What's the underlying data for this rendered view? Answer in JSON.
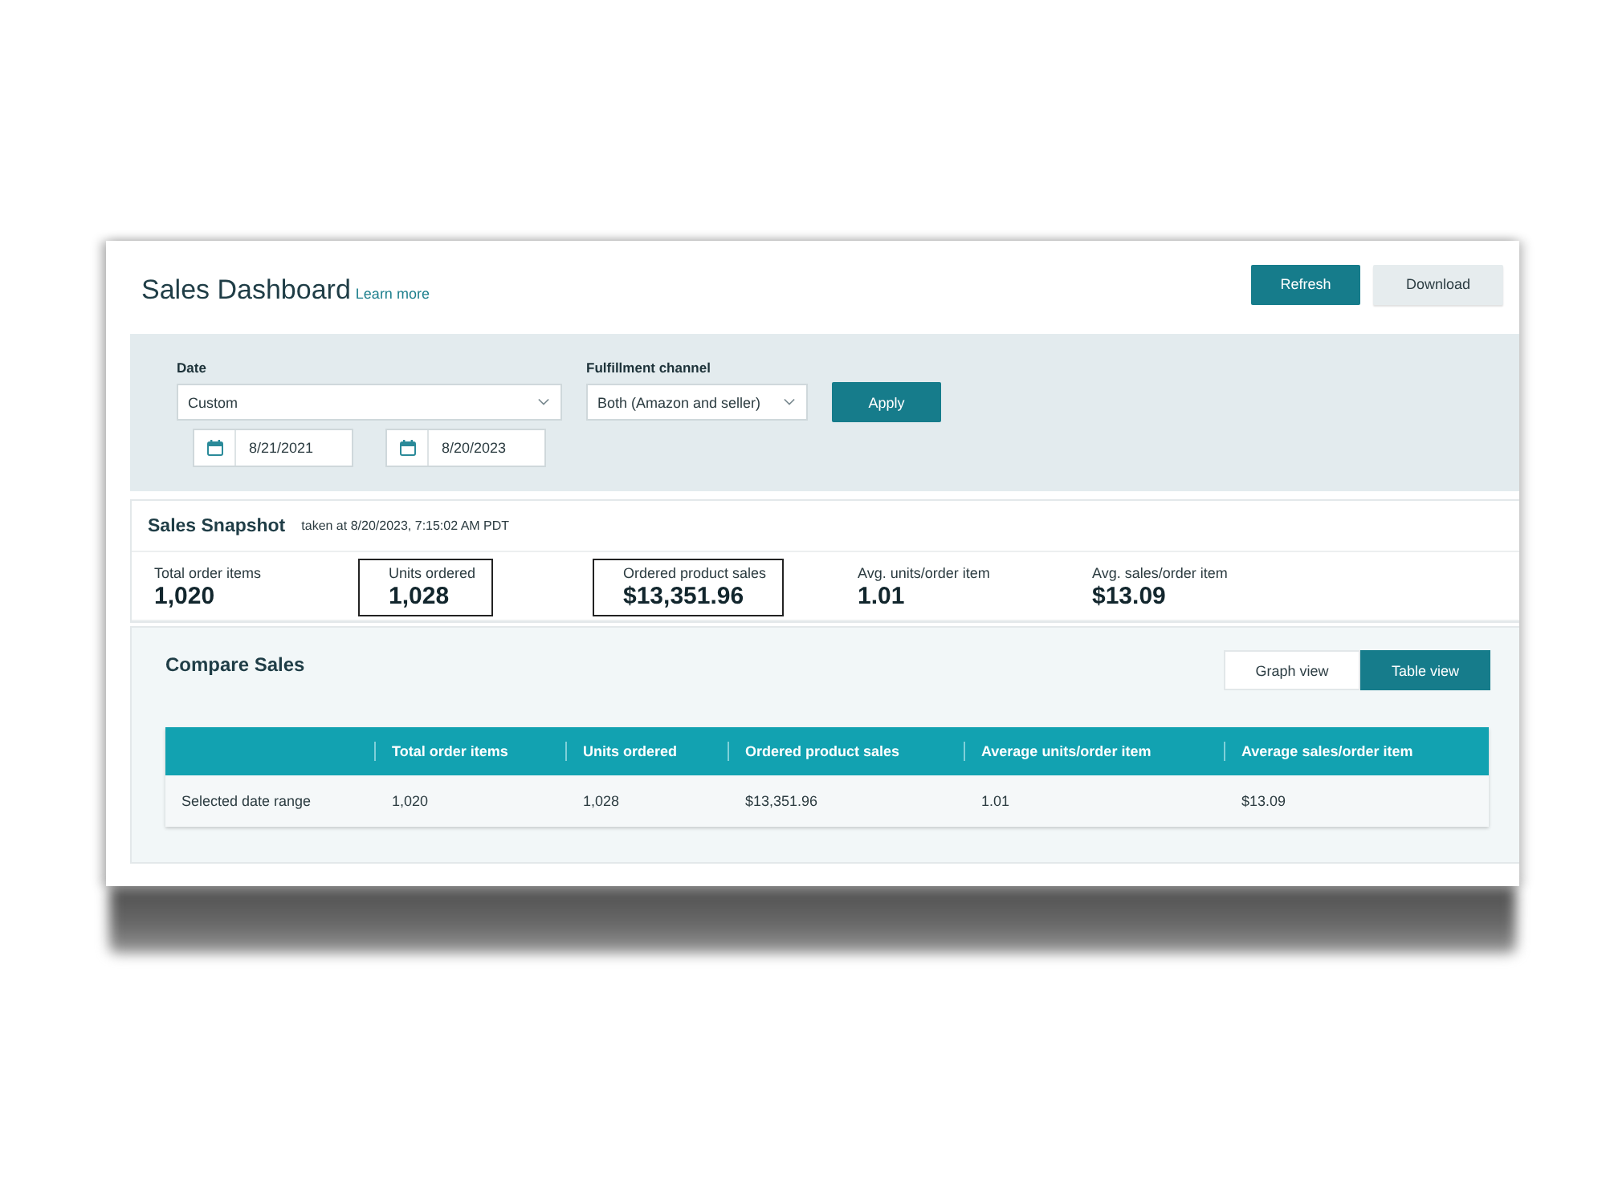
{
  "header": {
    "title": "Sales Dashboard",
    "link": "Learn more",
    "buttons": [
      {
        "label": "Refresh",
        "kind": "primary"
      },
      {
        "label": "Download",
        "kind": "secondary"
      }
    ]
  },
  "filters": {
    "date": {
      "label": "Date",
      "value": "Custom",
      "start": "8/21/2021",
      "end": "8/20/2023"
    },
    "fulfillment": {
      "label": "Fulfillment channel",
      "value": "Both (Amazon and seller)"
    },
    "apply": {
      "label": "Apply",
      "kind": "primary"
    }
  },
  "snapshot": {
    "title": "Sales Snapshot",
    "taken_at": "taken at 8/20/2023, 7:15:02 AM PDT",
    "metrics": [
      {
        "label": "Total order items",
        "value": "1,020",
        "highlighted": false
      },
      {
        "label": "Units ordered",
        "value": "1,028",
        "highlighted": true
      },
      {
        "label": "Ordered product sales",
        "value": "$13,351.96",
        "highlighted": true
      },
      {
        "label": "Avg. units/order item",
        "value": "1.01",
        "highlighted": false
      },
      {
        "label": "Avg. sales/order item",
        "value": "$13.09",
        "highlighted": false
      }
    ]
  },
  "compare": {
    "title": "Compare Sales",
    "views": [
      {
        "label": "Graph view",
        "selected": false
      },
      {
        "label": "Table view",
        "selected": true
      }
    ],
    "table": {
      "columns": [
        "Total order items",
        "Units ordered",
        "Ordered product sales",
        "Average units/order item",
        "Average sales/order item"
      ],
      "rows": [
        {
          "label": "Selected date range",
          "cells": [
            "1,020",
            "1,028",
            "$13,351.96",
            "1.01",
            "$13.09"
          ]
        }
      ]
    }
  }
}
